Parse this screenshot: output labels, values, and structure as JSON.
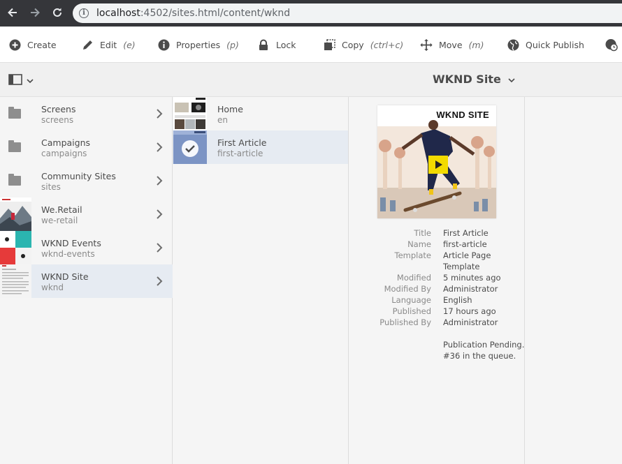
{
  "browser": {
    "url_host": "localhost",
    "url_rest": ":4502/sites.html/content/wknd"
  },
  "actions": [
    {
      "label": "Create",
      "shortcut": "",
      "icon": "create-plus-icon"
    },
    {
      "label": "Edit",
      "shortcut": "(e)",
      "icon": "pencil-icon"
    },
    {
      "label": "Properties",
      "shortcut": "(p)",
      "icon": "info-icon"
    },
    {
      "label": "Lock",
      "shortcut": "",
      "icon": "lock-icon"
    },
    {
      "label": "Copy",
      "shortcut": "(ctrl+c)",
      "icon": "copy-icon"
    },
    {
      "label": "Move",
      "shortcut": "(m)",
      "icon": "move-icon"
    },
    {
      "label": "Quick Publish",
      "shortcut": "",
      "icon": "globe-icon"
    }
  ],
  "header": {
    "title": "WKND Site"
  },
  "column1": [
    {
      "title": "Screens",
      "name": "screens",
      "type": "folder"
    },
    {
      "title": "Campaigns",
      "name": "campaigns",
      "type": "folder"
    },
    {
      "title": "Community Sites",
      "name": "sites",
      "type": "folder"
    },
    {
      "title": "We.Retail",
      "name": "we-retail",
      "type": "thumb"
    },
    {
      "title": "WKND Events",
      "name": "wknd-events",
      "type": "thumb"
    },
    {
      "title": "WKND Site",
      "name": "wknd",
      "type": "thumb",
      "selected": true
    }
  ],
  "column2": [
    {
      "title": "Home",
      "name": "en"
    },
    {
      "title": "First Article",
      "name": "first-article",
      "selected": true
    }
  ],
  "preview": {
    "brand": "WKND SITE",
    "meta": [
      {
        "key": "Title",
        "value": "First Article"
      },
      {
        "key": "Name",
        "value": "first-article"
      },
      {
        "key": "Template",
        "value": "Article Page"
      },
      {
        "key": "",
        "value": "Template"
      },
      {
        "key": "Modified",
        "value": "5 minutes ago"
      },
      {
        "key": "Modified By",
        "value": "Administrator"
      },
      {
        "key": "Language",
        "value": "English"
      },
      {
        "key": "Published",
        "value": "17 hours ago"
      },
      {
        "key": "Published By",
        "value": "Administrator"
      }
    ],
    "status_line1": "Publication Pending.",
    "status_line2": "#36 in the queue."
  }
}
